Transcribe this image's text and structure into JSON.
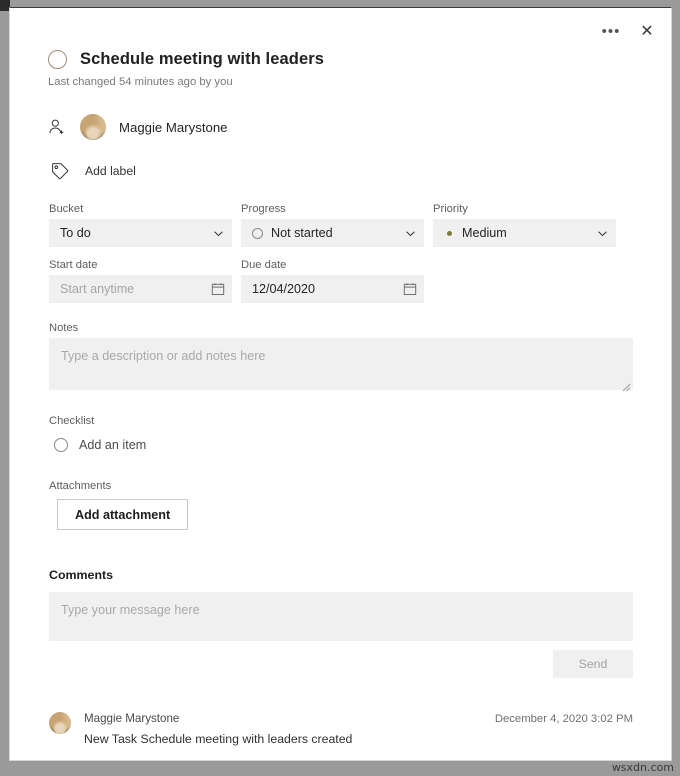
{
  "window": {
    "more_options_label": "•••",
    "close_label": "✕"
  },
  "task": {
    "title": "Schedule meeting with leaders",
    "last_changed": "Last changed 54 minutes ago by you",
    "assignee": "Maggie Marystone",
    "add_label": "Add label"
  },
  "fields": {
    "bucket": {
      "label": "Bucket",
      "value": "To do"
    },
    "progress": {
      "label": "Progress",
      "value": "Not started"
    },
    "priority": {
      "label": "Priority",
      "value": "Medium",
      "dot_color": "#7a7a3c"
    },
    "start_date": {
      "label": "Start date",
      "value": "Start anytime",
      "is_placeholder": true
    },
    "due_date": {
      "label": "Due date",
      "value": "12/04/2020",
      "is_placeholder": false
    }
  },
  "notes": {
    "label": "Notes",
    "placeholder": "Type a description or add notes here",
    "value": ""
  },
  "checklist": {
    "label": "Checklist",
    "add_item_label": "Add an item"
  },
  "attachments": {
    "label": "Attachments",
    "add_button_label": "Add attachment"
  },
  "comments": {
    "title": "Comments",
    "placeholder": "Type your message here",
    "value": "",
    "send_label": "Send"
  },
  "activity": [
    {
      "author": "Maggie Marystone",
      "timestamp": "December 4, 2020 3:02 PM",
      "text": "New Task Schedule meeting with leaders created"
    }
  ],
  "watermark": "wsxdn.com",
  "colors": {
    "field_background": "#f0f0f0",
    "panel_background": "#ffffff",
    "outer_background": "#9a9a9a"
  }
}
